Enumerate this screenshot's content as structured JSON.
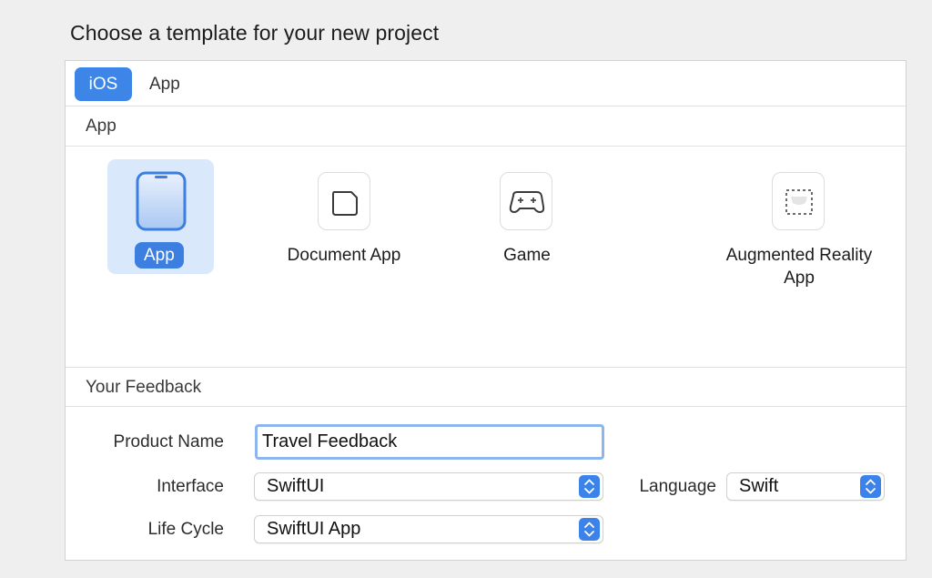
{
  "page": {
    "title": "Choose a template for your new project"
  },
  "tabs": [
    {
      "label": "iOS",
      "selected": true
    },
    {
      "label": "App",
      "selected": false
    }
  ],
  "sections": {
    "app": "App",
    "feedback": "Your Feedback"
  },
  "templates": [
    {
      "label": "App",
      "icon": "iphone-icon",
      "selected": true
    },
    {
      "label": "Document App",
      "icon": "document-icon",
      "selected": false
    },
    {
      "label": "Game",
      "icon": "game-controller-icon",
      "selected": false
    },
    {
      "label_line1": "Augmented Reality",
      "label_line2": "App",
      "icon": "augmented-reality-icon",
      "selected": false
    }
  ],
  "form": {
    "product_name_label": "Product Name",
    "product_name_value": "Travel Feedback",
    "interface_label": "Interface",
    "interface_value": "SwiftUI",
    "language_label": "Language",
    "language_value": "Swift",
    "life_cycle_label": "Life Cycle",
    "life_cycle_value": "SwiftUI App"
  },
  "colors": {
    "accent": "#3d86e8",
    "selection_bg": "#d9e8fb",
    "focus_ring": "#8db6ef"
  }
}
